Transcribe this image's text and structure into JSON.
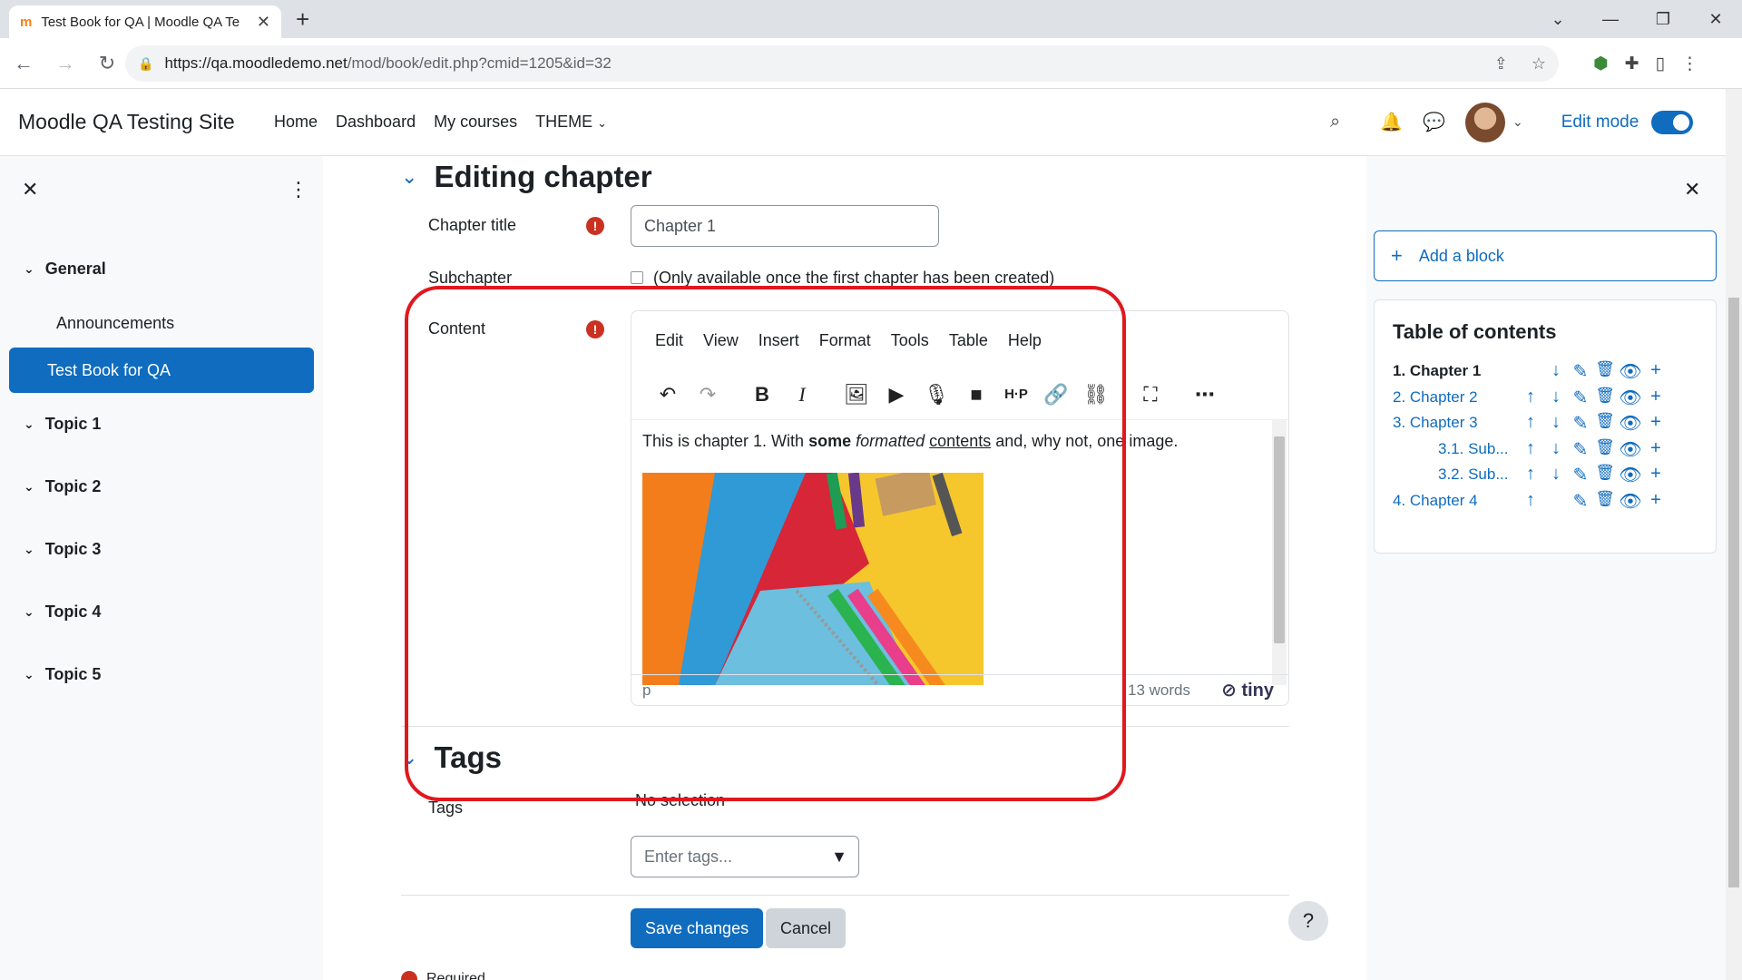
{
  "browser": {
    "tab_title": "Test Book for QA | Moodle QA Te",
    "tab_favicon": "moodle-logo",
    "url_host": "https://qa.moodledemo.net",
    "url_path": "/mod/book/edit.php?cmid=1205&id=32"
  },
  "navbar": {
    "site_name": "Moodle QA Testing Site",
    "links": [
      "Home",
      "Dashboard",
      "My courses",
      "THEME"
    ],
    "edit_mode_label": "Edit mode",
    "edit_mode_on": true
  },
  "course_index": {
    "sections": [
      {
        "name": "General",
        "items": [
          {
            "label": "Announcements",
            "active": false
          },
          {
            "label": "Test Book for QA",
            "active": true
          }
        ]
      },
      {
        "name": "Topic 1",
        "items": []
      },
      {
        "name": "Topic 2",
        "items": []
      },
      {
        "name": "Topic 3",
        "items": []
      },
      {
        "name": "Topic 4",
        "items": []
      },
      {
        "name": "Topic 5",
        "items": []
      }
    ]
  },
  "form": {
    "section_title": "Editing chapter",
    "chapter_title_label": "Chapter title",
    "chapter_title_value": "Chapter 1",
    "subchapter_label": "Subchapter",
    "subchapter_note": "(Only available once the first chapter has been created)",
    "content_label": "Content",
    "editor": {
      "menu": [
        "Edit",
        "View",
        "Insert",
        "Format",
        "Tools",
        "Table",
        "Help"
      ],
      "content_text": {
        "part1": "This is chapter 1. With ",
        "bold": "some",
        "space1": " ",
        "italic": "formatted",
        "space2": " ",
        "underline": "contents",
        "part2": " and, why not, one image."
      },
      "status_path": "p",
      "word_count": "13 words",
      "brand": "tiny"
    },
    "tags_section_title": "Tags",
    "tags_label": "Tags",
    "tags_no_selection": "No selection",
    "tags_placeholder": "Enter tags...",
    "save_label": "Save changes",
    "cancel_label": "Cancel",
    "required_note": "Required",
    "help_label": "?"
  },
  "blocks": {
    "add_block_label": "Add a block",
    "toc_title": "Table of contents",
    "chapters": [
      {
        "label": "1. Chapter 1",
        "current": true,
        "indent": false
      },
      {
        "label": "2. Chapter 2",
        "current": false,
        "indent": false
      },
      {
        "label": "3. Chapter 3",
        "current": false,
        "indent": false
      },
      {
        "label": "3.1. Sub...",
        "current": false,
        "indent": true
      },
      {
        "label": "3.2. Sub...",
        "current": false,
        "indent": true
      },
      {
        "label": "4. Chapter 4",
        "current": false,
        "indent": false
      }
    ]
  },
  "colors": {
    "brand_blue": "#0f6cbf",
    "required_red": "#ca3120",
    "highlight_red": "#e0181e"
  }
}
